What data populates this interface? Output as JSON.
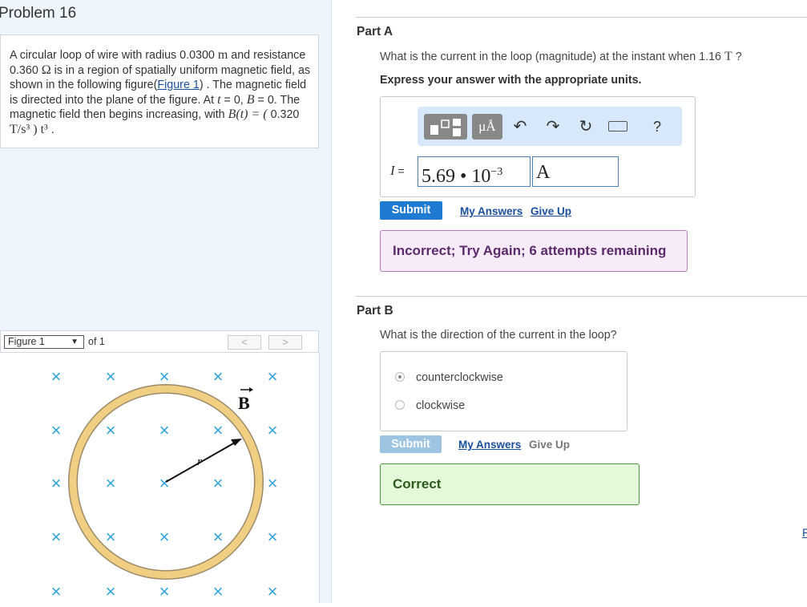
{
  "problem": {
    "title": "Problem 16",
    "text_a": "A circular loop of wire with radius 0.0300 ",
    "unit_m": "m",
    "text_b": " and resistance 0.360 ",
    "unit_ohm": "Ω",
    "text_c": " is in a region of spatially uniform magnetic field, as shown in the following figure(",
    "figure_link": "Figure 1",
    "text_d": ") . The magnetic field is directed into the plane of the figure. At ",
    "t_sym": "t",
    "text_e": " = 0, ",
    "b_sym": "B",
    "text_f": " = 0. The magnetic field then begins increasing, with ",
    "bt_expr": "B(t) = (",
    "bt_coef": "0.320",
    "bt_unit": "T/s³",
    "bt_tail": ") t³",
    "text_g": " ."
  },
  "figure_nav": {
    "select_value": "Figure 1",
    "of_text": "of 1",
    "prev": "<",
    "next": ">"
  },
  "figure": {
    "field_label": "B",
    "radius_label": "r",
    "cross": "×",
    "colors": {
      "cross": "#2ea3da",
      "ring_outer": "#9b8a6a",
      "ring_fill": "#f1cf82"
    }
  },
  "part_a": {
    "title": "Part A",
    "question_pre": "What is the current in the loop (magnitude) at the instant when 1.16 ",
    "question_unit": "T",
    "question_post": " ?",
    "instruction": "Express your answer with the appropriate units.",
    "toolbar": {
      "units_glyph": "μÅ",
      "help": "?"
    },
    "input_label_var": "I",
    "input_label_eq": " =",
    "value_mantissa": "5.69 • 10",
    "value_exp": "−3",
    "unit_value": "A",
    "submit": "Submit",
    "my_answers": "My Answers",
    "give_up": "Give Up",
    "feedback": "Incorrect; Try Again; 6 attempts remaining"
  },
  "part_b": {
    "title": "Part B",
    "question": "What is the direction of the current in the loop?",
    "options": [
      "counterclockwise",
      "clockwise"
    ],
    "selected": "counterclockwise",
    "submit": "Submit",
    "my_answers": "My Answers",
    "give_up": "Give Up",
    "feedback": "Correct"
  },
  "edge_link": "F",
  "colors": {
    "submit_active": "#1f7ad1",
    "submit_disabled": "#9dc4e3",
    "incorrect_bg": "#f8ebf9",
    "incorrect_border": "#b57ab8",
    "incorrect_text": "#5c2b6b",
    "correct_bg": "#e4f8da",
    "correct_border": "#4f9a3c",
    "correct_text": "#2e5a1b"
  }
}
